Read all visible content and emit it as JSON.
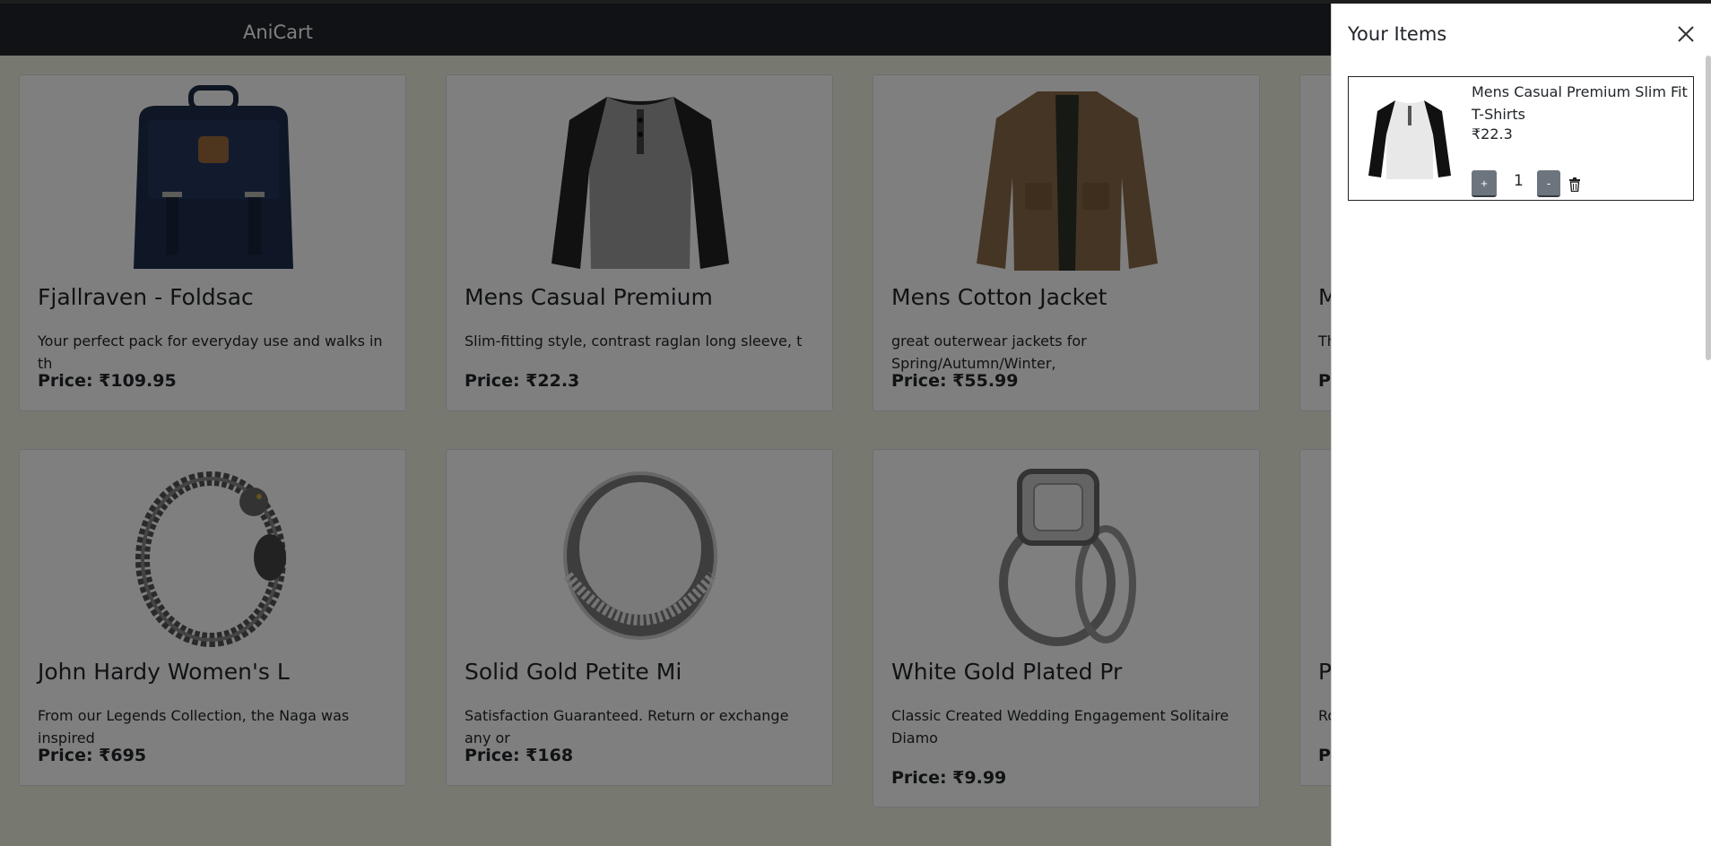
{
  "app": {
    "brand": "AniCart"
  },
  "products": [
    {
      "title": "Fjallraven - Foldsac",
      "description": "Your perfect pack for everyday use and walks in th",
      "price_label": "Price: ₹109.95",
      "icon": "backpack"
    },
    {
      "title": "Mens Casual Premium",
      "description": "Slim-fitting style, contrast raglan long sleeve, t",
      "price_label": "Price: ₹22.3",
      "icon": "raglan-tshirt"
    },
    {
      "title": "Mens Cotton Jacket",
      "description": "great outerwear jackets for Spring/Autumn/Winter,",
      "price_label": "Price: ₹55.99",
      "icon": "jacket"
    },
    {
      "title": "M",
      "description": "Th",
      "price_label": "P",
      "icon": "clothing"
    },
    {
      "title": "John Hardy Women's L",
      "description": "From our Legends Collection, the Naga was inspired",
      "price_label": "Price: ₹695",
      "icon": "dragon-bracelet"
    },
    {
      "title": "Solid Gold Petite Mi",
      "description": "Satisfaction Guaranteed. Return or exchange any or",
      "price_label": "Price: ₹168",
      "icon": "ring"
    },
    {
      "title": "White Gold Plated Pr",
      "description": "Classic Created Wedding Engagement Solitaire Diamo",
      "price_label": "Price: ₹9.99",
      "icon": "engagement-ring"
    },
    {
      "title": "P",
      "description": "Ro",
      "price_label": "P",
      "icon": "jewelry"
    }
  ],
  "cart": {
    "title": "Your Items",
    "items": [
      {
        "name": "Mens Casual Premium Slim Fit T-Shirts",
        "price": "₹22.3",
        "quantity": "1",
        "plus_label": "+",
        "minus_label": "-",
        "icon": "raglan-tshirt"
      }
    ]
  },
  "colors": {
    "navbar": "#21252a",
    "page_bg": "#eef2e2",
    "button": "#6c757d"
  }
}
